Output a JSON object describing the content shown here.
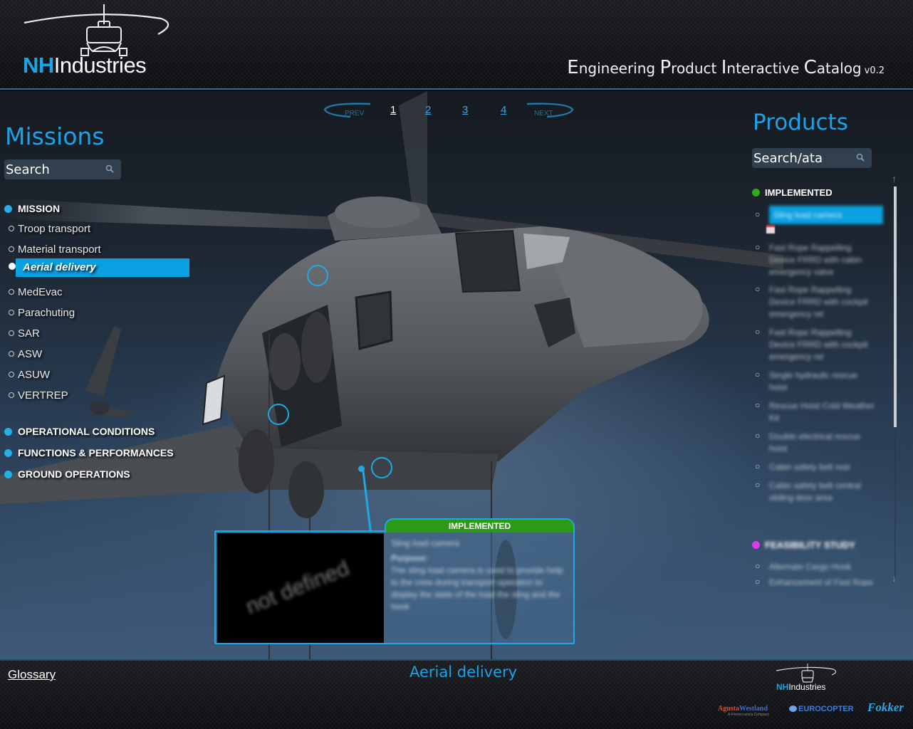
{
  "header": {
    "logo": {
      "nh": "NH",
      "industries": "Industries"
    },
    "title_parts": [
      {
        "cap": "E",
        "rest": "ngineering "
      },
      {
        "cap": "P",
        "rest": "roduct "
      },
      {
        "cap": "I",
        "rest": "nteractive "
      },
      {
        "cap": "C",
        "rest": "atalog"
      }
    ],
    "version": "v0.2"
  },
  "pager": {
    "prev_label": "PREV",
    "next_label": "NEXT",
    "pages": [
      "1",
      "2",
      "3",
      "4"
    ],
    "current_page": "1"
  },
  "missions": {
    "title": "Missions",
    "search_placeholder": "Search",
    "categories": [
      {
        "label": "MISSION",
        "items": [
          {
            "label": "Troop transport",
            "selected": false
          },
          {
            "label": "Material transport",
            "selected": false
          },
          {
            "label": "Aerial delivery",
            "selected": true
          },
          {
            "label": "MedEvac",
            "selected": false
          },
          {
            "label": "Parachuting",
            "selected": false
          },
          {
            "label": "SAR",
            "selected": false
          },
          {
            "label": "ASW",
            "selected": false
          },
          {
            "label": "ASUW",
            "selected": false
          },
          {
            "label": "VERTREP",
            "selected": false
          }
        ]
      },
      {
        "label": "OPERATIONAL CONDITIONS",
        "items": []
      },
      {
        "label": "FUNCTIONS & PERFORMANCES",
        "items": []
      },
      {
        "label": "GROUND OPERATIONS",
        "items": []
      }
    ]
  },
  "products": {
    "title": "Products",
    "search_placeholder": "Search/ata",
    "groups": [
      {
        "label": "IMPLEMENTED",
        "color": "#2fa81c",
        "items": [
          {
            "label": "Sling load camera",
            "selected": true
          },
          {
            "label": "Fast Rope Rappelling Device FRRD with cabin emergency valve",
            "selected": false
          },
          {
            "label": "Fast Rope Rappelling Device FRRD with cockpit emergency rel",
            "selected": false
          },
          {
            "label": "Fast Rope Rappelling Device FRRD with cockpit emergency rel",
            "selected": false
          },
          {
            "label": "Single hydraulic rescue hoist",
            "selected": false
          },
          {
            "label": "Rescue Hoist Cold Weather Kit",
            "selected": false
          },
          {
            "label": "Double electrical rescue hoist",
            "selected": false
          },
          {
            "label": "Cabin safety belt rear",
            "selected": false
          },
          {
            "label": "Cabin safety belt central sliding door area",
            "selected": false
          }
        ]
      },
      {
        "label": "FEASIBILITY STUDY",
        "color": "#d63ce8",
        "items": [
          {
            "label": "Alternate Cargo Hook",
            "selected": false
          },
          {
            "label": "Enhancement of Fast Rope",
            "selected": false
          }
        ]
      }
    ]
  },
  "popup": {
    "status": "IMPLEMENTED",
    "status_color": "#2a9a17",
    "image_placeholder": "not defined",
    "product_name": "Sling load camera",
    "purpose_label": "Purpose:",
    "purpose_text": "The sling load camera is used to provide help to the crew during transport operation to display the state of the load the sling and the hook"
  },
  "footer": {
    "glossary_label": "Glossary",
    "current_mission": "Aerial delivery",
    "partners": {
      "agusta": {
        "a": "Agusta",
        "w": "Westland",
        "sub": "A Finmeccanica Company"
      },
      "eurocopter": "EUROCOPTER",
      "fokker": "Fokker"
    }
  },
  "colors": {
    "accent": "#1aa3e8",
    "selected_bg": "#0ba0df",
    "implemented": "#2fa81c",
    "feasibility": "#d63ce8"
  }
}
